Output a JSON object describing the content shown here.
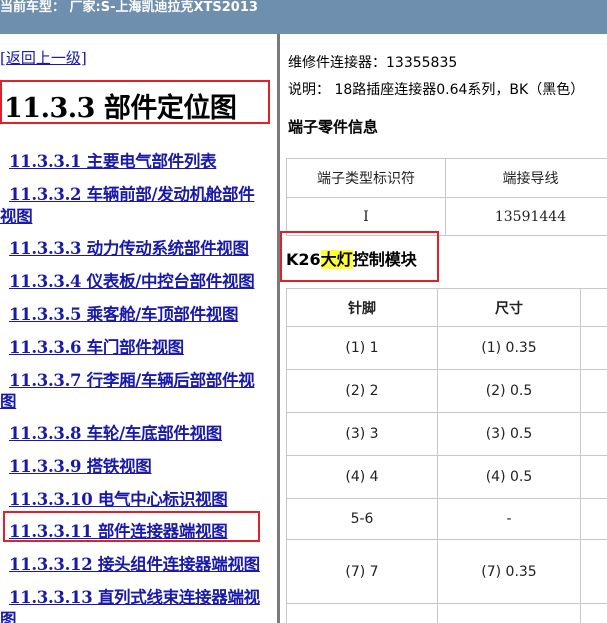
{
  "window": {
    "title": "当前车型： 厂家:S-上海凯迪拉克XTS2013",
    "accent_color": "#6f8fae"
  },
  "left_pane": {
    "back_link": "[返回上一级]",
    "heading": "11.3.3 部件定位图",
    "nav_items": [
      {
        "line1": "11.3.3.1 主要电气部件列表",
        "line2": ""
      },
      {
        "line1": "11.3.3.2 车辆前部/发动机舱部件",
        "line2": "视图"
      },
      {
        "line1": "11.3.3.3 动力传动系统部件视图",
        "line2": ""
      },
      {
        "line1": "11.3.3.4 仪表板/中控台部件视图",
        "line2": ""
      },
      {
        "line1": "11.3.3.5 乘客舱/车顶部件视图",
        "line2": ""
      },
      {
        "line1": "11.3.3.6 车门部件视图",
        "line2": ""
      },
      {
        "line1": "11.3.3.7 行李厢/车辆后部部件视",
        "line2": "图"
      },
      {
        "line1": "11.3.3.8 车轮/车底部件视图",
        "line2": ""
      },
      {
        "line1": "11.3.3.9 搭铁视图",
        "line2": ""
      },
      {
        "line1": "11.3.3.10 电气中心标识视图",
        "line2": ""
      },
      {
        "line1": "11.3.3.11 部件连接器端视图",
        "line2": ""
      },
      {
        "line1": "11.3.3.12 接头组件连接器端视图",
        "line2": ""
      },
      {
        "line1": "11.3.3.13 直列式线束连接器端视",
        "line2": "图"
      }
    ]
  },
  "right_pane": {
    "repair_connector_label": "维修件连接器：",
    "repair_connector_value": "13355835",
    "description": "说明：  18路插座连接器0.64系列，BK（黑色）",
    "terminal_section_title": "端子零件信息",
    "terminal_table": {
      "headers": [
        "端子类型标识符",
        "端接导线"
      ],
      "rows": [
        [
          "I",
          "13591444"
        ]
      ]
    },
    "module_title_prefix": "K26",
    "module_title_highlight": "大灯",
    "module_title_suffix": "控制模块",
    "pin_table": {
      "headers": [
        "针脚",
        "尺寸"
      ],
      "rows": [
        [
          "(1) 1",
          "(1) 0.35"
        ],
        [
          "(2) 2",
          "(2) 0.5"
        ],
        [
          "(3) 3",
          "(3) 0.5"
        ],
        [
          "(4) 4",
          "(4) 0.5"
        ],
        [
          "5-6",
          "-"
        ],
        [
          "(7) 7",
          "(7) 0.35"
        ]
      ]
    }
  }
}
